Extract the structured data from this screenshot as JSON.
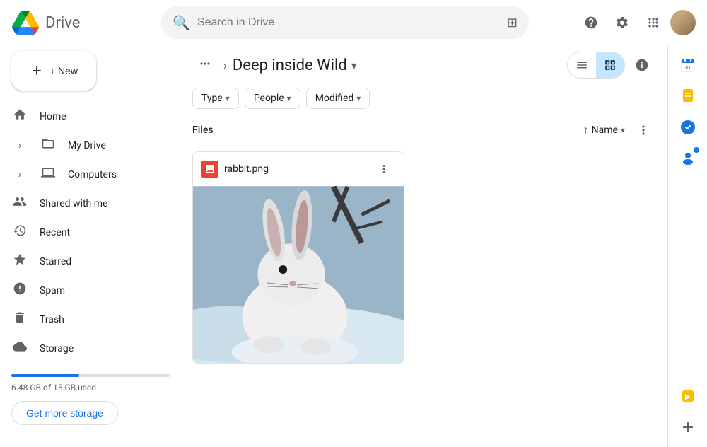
{
  "app": {
    "title": "Drive",
    "logo_alt": "Google Drive"
  },
  "topbar": {
    "search_placeholder": "Search in Drive",
    "filter_icon": "⊞",
    "help_icon": "?",
    "settings_icon": "⚙",
    "apps_icon": "⋮⋮⋮"
  },
  "sidebar": {
    "new_label": "+ New",
    "nav_items": [
      {
        "id": "home",
        "label": "Home",
        "icon": "🏠"
      },
      {
        "id": "my-drive",
        "label": "My Drive",
        "icon": "📁",
        "has_arrow": true
      },
      {
        "id": "computers",
        "label": "Computers",
        "icon": "💻",
        "has_arrow": true
      },
      {
        "id": "shared",
        "label": "Shared with me",
        "icon": "👥"
      },
      {
        "id": "recent",
        "label": "Recent",
        "icon": "🕐"
      },
      {
        "id": "starred",
        "label": "Starred",
        "icon": "☆"
      },
      {
        "id": "spam",
        "label": "Spam",
        "icon": "⚠"
      },
      {
        "id": "trash",
        "label": "Trash",
        "icon": "🗑"
      },
      {
        "id": "storage",
        "label": "Storage",
        "icon": "☁"
      }
    ],
    "storage": {
      "used": "6.48 GB of 15 GB used",
      "percent": 43,
      "get_more_label": "Get more storage"
    }
  },
  "breadcrumb": {
    "dots": "•••",
    "arrow": "›",
    "title": "Deep inside Wild",
    "chevron": "▾"
  },
  "view_controls": {
    "list_icon": "☰",
    "grid_icon": "⊞",
    "active": "grid",
    "info_icon": "ℹ"
  },
  "filters": {
    "type_label": "Type",
    "people_label": "People",
    "modified_label": "Modified"
  },
  "files": {
    "section_label": "Files",
    "sort_arrow": "↑",
    "sort_label": "Name",
    "items": [
      {
        "name": "rabbit.png",
        "type": "image",
        "icon_color": "#ea4335"
      }
    ]
  },
  "right_panel": {
    "calendar_icon": "📅",
    "notes_icon": "📝",
    "tasks_icon": "✓",
    "contacts_icon": "👤",
    "promo_icon": "🟡",
    "add_icon": "+"
  }
}
